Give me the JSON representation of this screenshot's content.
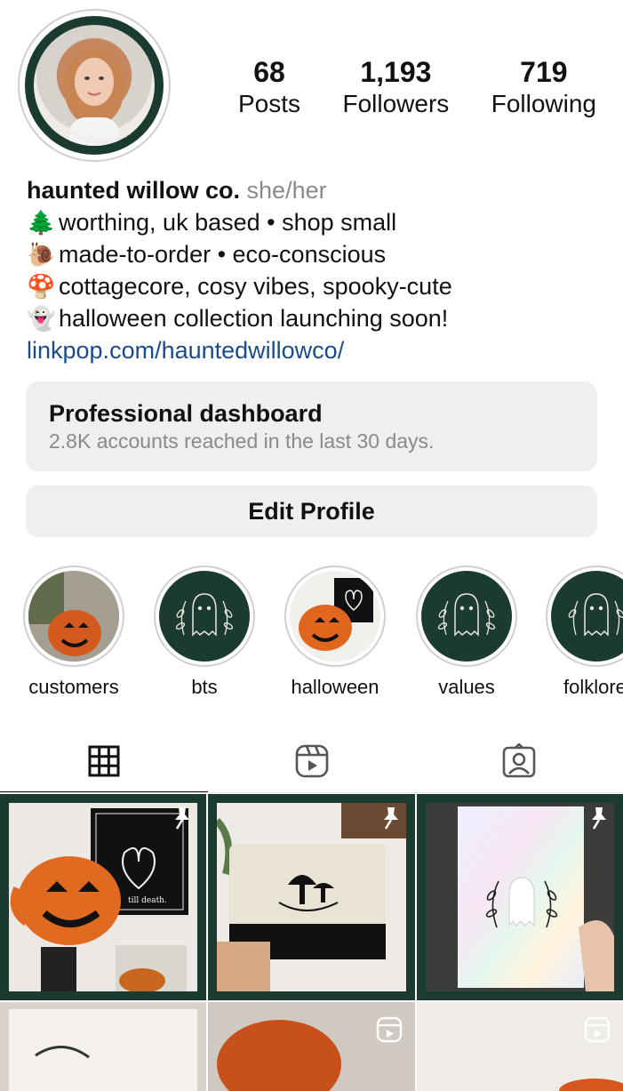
{
  "profile": {
    "avatar_mark": "haunted willow co",
    "stats": [
      {
        "value": "68",
        "label": "Posts"
      },
      {
        "value": "1,193",
        "label": "Followers"
      },
      {
        "value": "719",
        "label": "Following"
      }
    ],
    "name": "haunted willow co.",
    "pronouns": "she/her",
    "bio_lines": [
      {
        "emoji": "🌲",
        "text": "worthing, uk based • shop small"
      },
      {
        "emoji": "🐌",
        "text": "made-to-order • eco-conscious"
      },
      {
        "emoji": "🍄",
        "text": "cottagecore, cosy vibes, spooky-cute"
      },
      {
        "emoji": "👻",
        "text": "halloween collection launching soon!"
      }
    ],
    "link": "linkpop.com/hauntedwillowco/"
  },
  "dashboard": {
    "title": "Professional dashboard",
    "subtitle": "2.8K accounts reached in the last 30 days."
  },
  "edit_profile_label": "Edit Profile",
  "highlights": [
    {
      "label": "customers",
      "cover": "pumpkin mug photo"
    },
    {
      "label": "bts",
      "cover": "ghost logo"
    },
    {
      "label": "halloween",
      "cover": "pumpkin mug photo"
    },
    {
      "label": "values",
      "cover": "ghost logo"
    },
    {
      "label": "folklore",
      "cover": "ghost logo"
    }
  ],
  "tabs": [
    {
      "name": "grid-icon",
      "active": true
    },
    {
      "name": "reels-icon",
      "active": false
    },
    {
      "name": "tagged-icon",
      "active": false
    }
  ],
  "posts": [
    {
      "type": "pinned",
      "subject": "pumpkin mug with till death print",
      "print_text": "till death."
    },
    {
      "type": "pinned",
      "subject": "mushroom zip pouch"
    },
    {
      "type": "pinned",
      "subject": "holographic ghost print"
    },
    {
      "type": "reel",
      "subject": "open book"
    },
    {
      "type": "reel",
      "subject": "orange pumpkin"
    },
    {
      "type": "reel",
      "subject": "light room"
    }
  ],
  "colors": {
    "brand_green": "#1b3a30",
    "link": "#1a4b8c",
    "button_bg": "#efefef",
    "muted": "#8a8a8a"
  }
}
